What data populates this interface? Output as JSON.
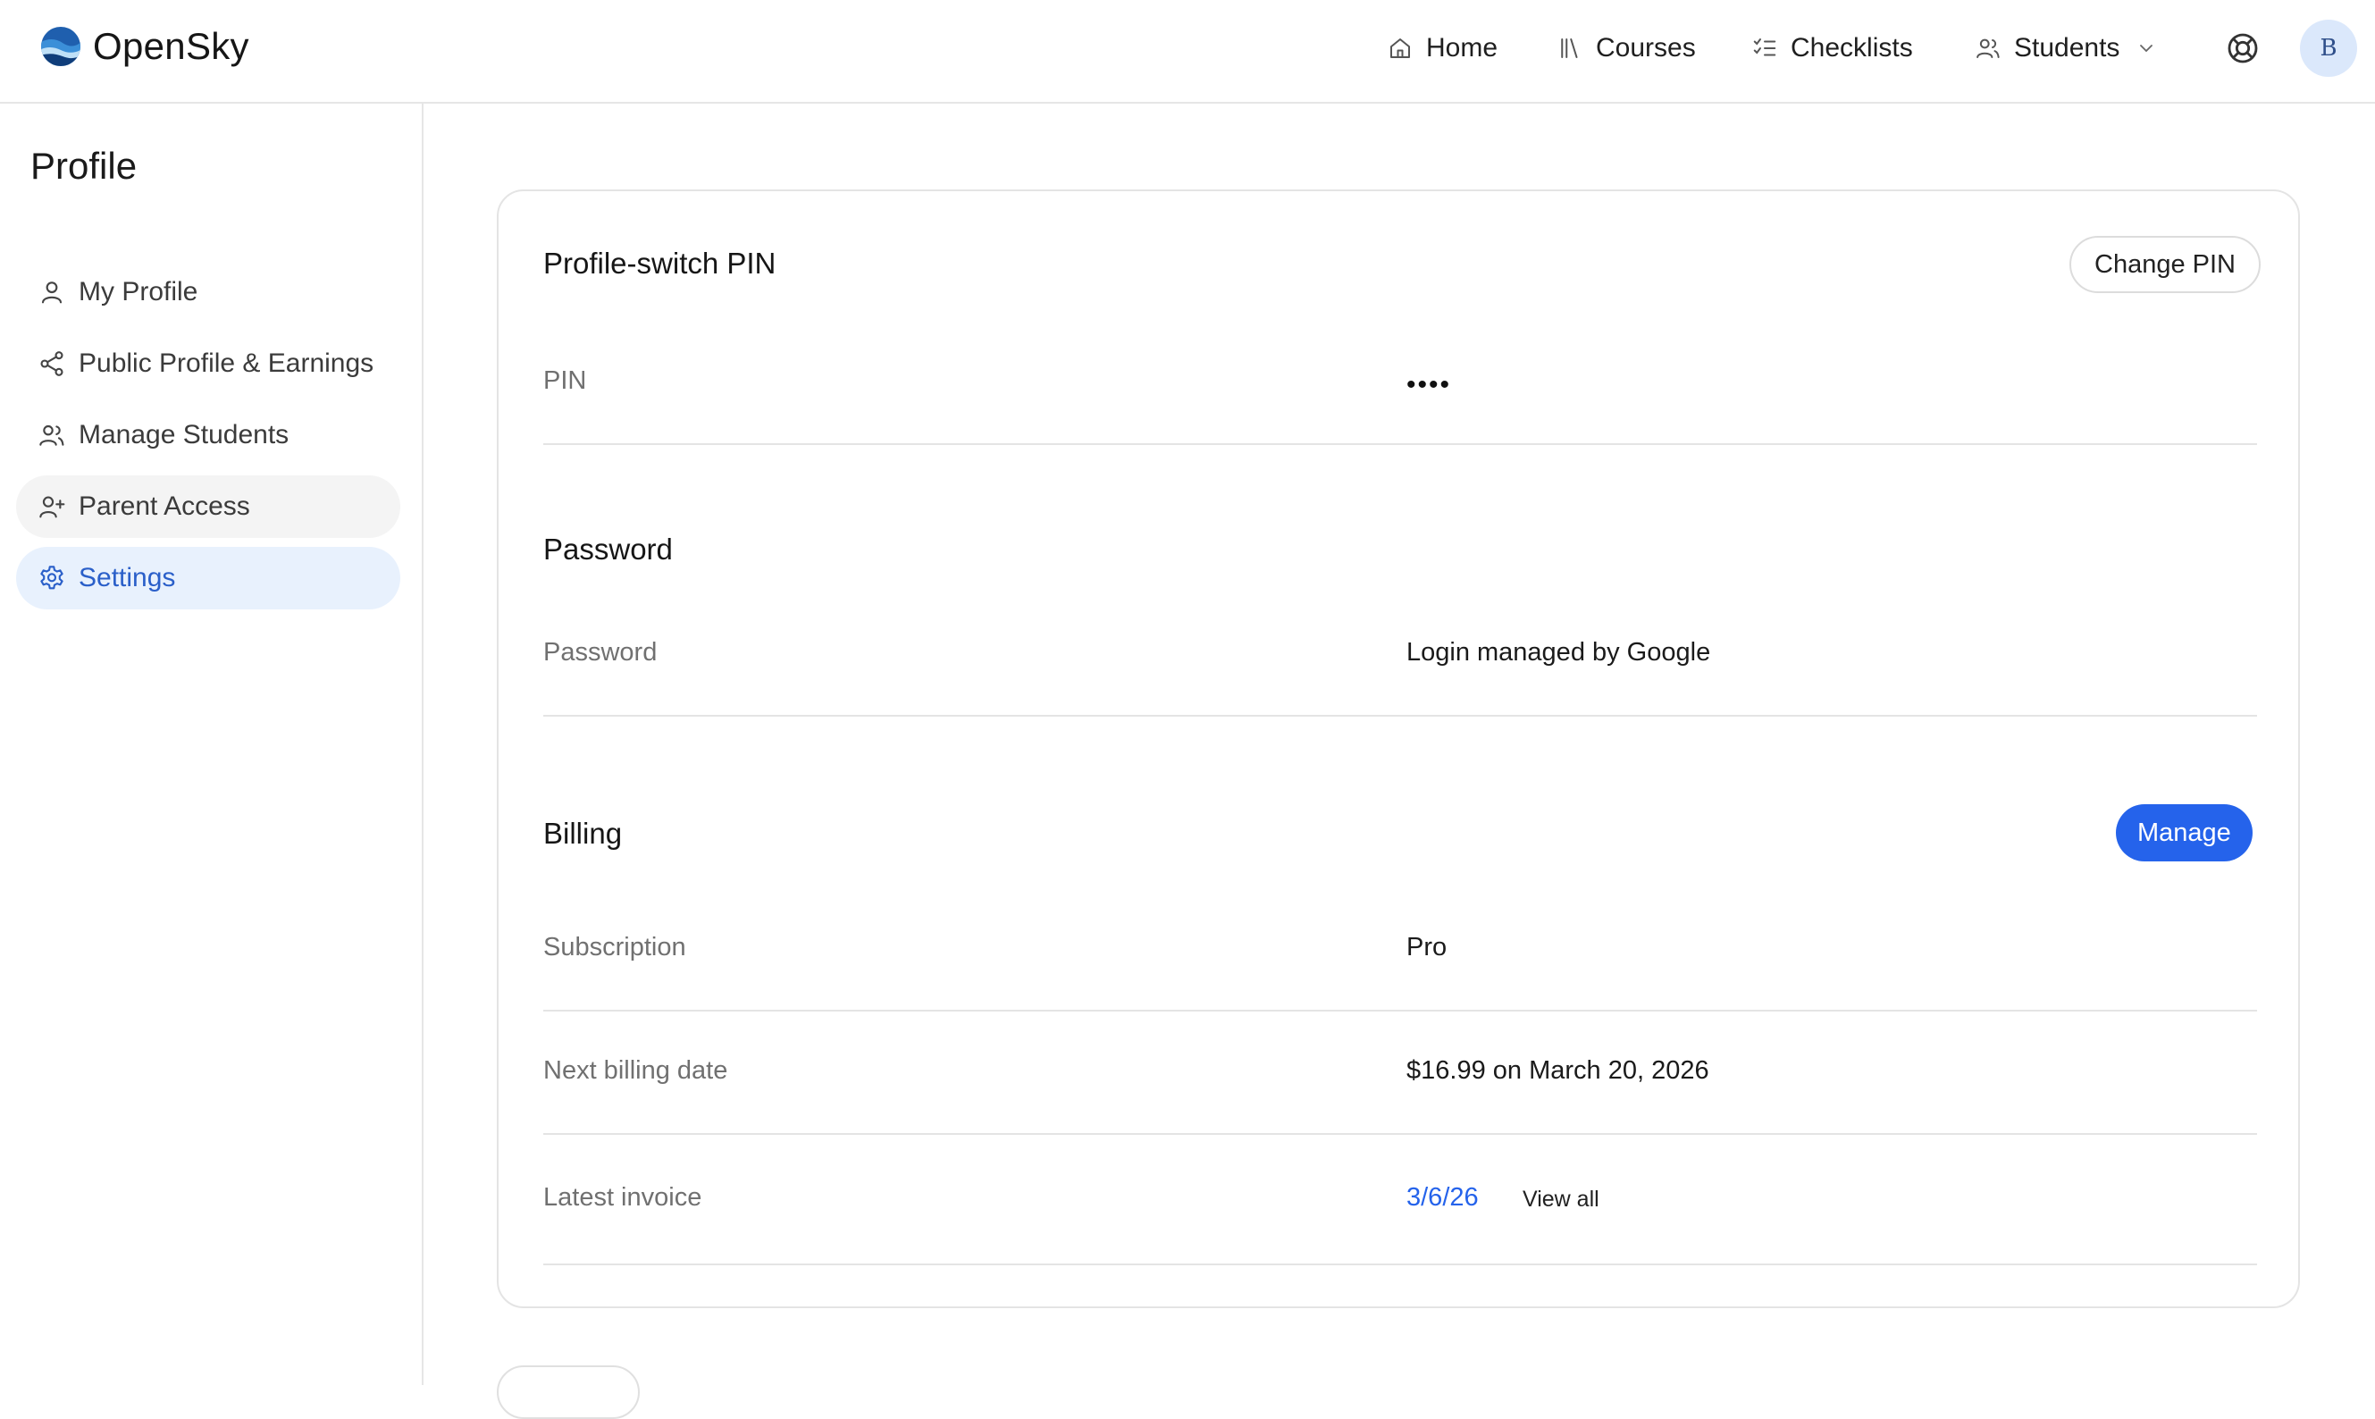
{
  "app": {
    "name": "OpenSky",
    "avatar_initial": "B"
  },
  "nav": {
    "home": "Home",
    "courses": "Courses",
    "checklists": "Checklists",
    "students": "Students"
  },
  "sidebar": {
    "title": "Profile",
    "items": [
      {
        "label": "My Profile",
        "icon": "user-icon"
      },
      {
        "label": "Public Profile & Earnings",
        "icon": "share-icon"
      },
      {
        "label": "Manage Students",
        "icon": "users-icon"
      },
      {
        "label": "Parent Access",
        "icon": "user-plus-icon"
      },
      {
        "label": "Settings",
        "icon": "gear-icon",
        "active": true
      }
    ]
  },
  "pin_section": {
    "title": "Profile-switch PIN",
    "button": "Change PIN",
    "label": "PIN",
    "value": "••••"
  },
  "password_section": {
    "title": "Password",
    "label": "Password",
    "value": "Login managed by Google"
  },
  "billing_section": {
    "title": "Billing",
    "button": "Manage",
    "subscription_label": "Subscription",
    "subscription_value": "Pro",
    "next_billing_label": "Next billing date",
    "next_billing_value": "$16.99 on March 20, 2026",
    "invoice_label": "Latest invoice",
    "invoice_date": "3/6/26",
    "view_all": "View all"
  },
  "colors": {
    "accent": "#2563eb",
    "active_bg": "#e8f1fd",
    "border": "#e4e4e4"
  }
}
